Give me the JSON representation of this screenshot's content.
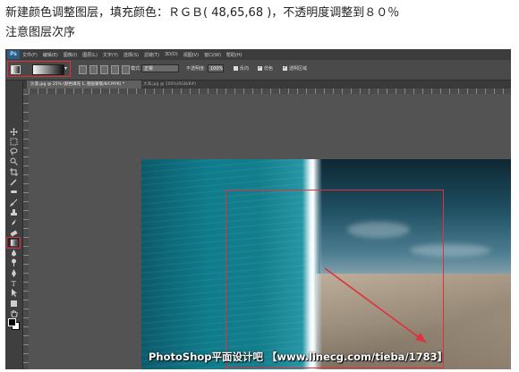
{
  "instructions": {
    "line1": "新建颜色调整图层，填充颜色：ＲＧＢ( 48,65,68 )，不透明度调整到８０％",
    "line2": "注意图层次序"
  },
  "menubar": {
    "app_logo": "Ps",
    "items": [
      "文件(F)",
      "编辑(E)",
      "图像(I)",
      "图层(L)",
      "文字(Y)",
      "选择(S)",
      "滤镜(T)",
      "3D(D)",
      "视图(V)",
      "窗口(W)",
      "帮助(H)"
    ]
  },
  "options_bar": {
    "mode_label": "模式:",
    "mode_value": "正常",
    "opacity_label": "不透明度:",
    "opacity_value": "100%",
    "reverse_label": "反向",
    "dither_label": "仿色",
    "transparency_label": "透明区域"
  },
  "tabs": {
    "active_label": "沙漠.jpg @ 25% (颜色填充 1, 图层蒙版/8/CMYK) *",
    "inactive_label": "大海.jpg @ 100%(RGB/8#)"
  },
  "toolbox": {
    "tools": [
      "move-icon",
      "marquee-icon",
      "lasso-icon",
      "quick-select-icon",
      "crop-icon",
      "eyedropper-icon",
      "healing-icon",
      "brush-icon",
      "stamp-icon",
      "history-brush-icon",
      "eraser-icon",
      "gradient-icon",
      "blur-icon",
      "dodge-icon",
      "pen-icon",
      "type-icon",
      "path-select-icon",
      "shape-icon",
      "hand-icon",
      "zoom-icon"
    ],
    "foreground_color": "#000000",
    "background_color": "#ffffff"
  },
  "canvas": {
    "watermark": "PhotoShop平面设计吧 【www.linecg.com/tieba/1783】"
  },
  "colors": {
    "highlight": "#e0303b",
    "ps_bg": "#535353"
  }
}
